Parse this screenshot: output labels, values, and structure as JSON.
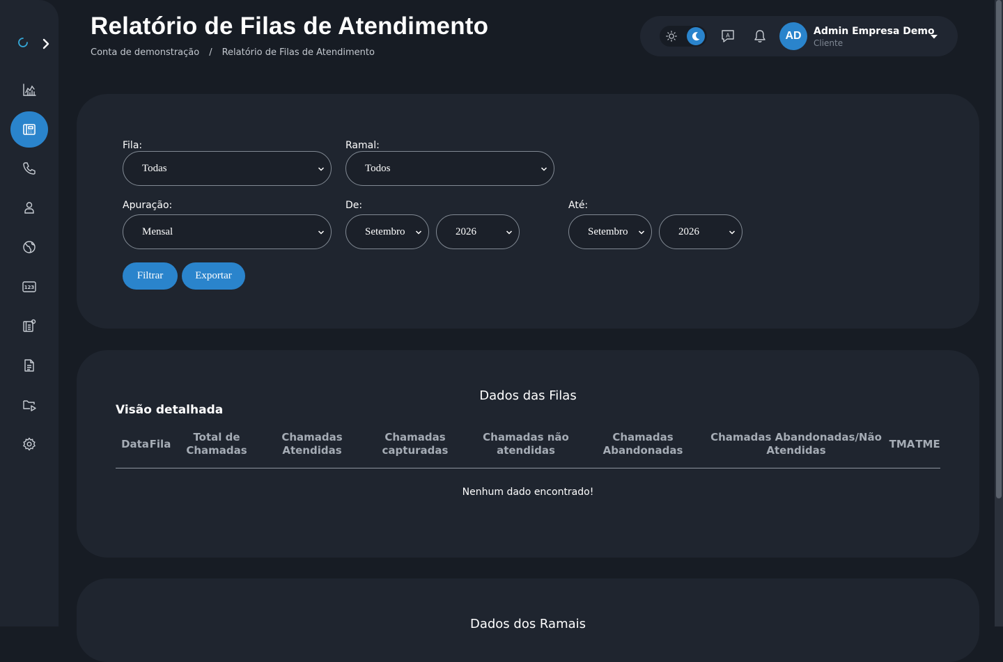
{
  "page": {
    "title": "Relatório de Filas de Atendimento",
    "breadcrumb": [
      "Conta de demonstração",
      "/",
      "Relatório de Filas de Atendimento"
    ]
  },
  "sidebar": {
    "items": [
      {
        "icon": "chart-icon",
        "active": false
      },
      {
        "icon": "queue-report-icon",
        "active": true
      },
      {
        "icon": "phone-icon",
        "active": false
      },
      {
        "icon": "user-icon",
        "active": false
      },
      {
        "icon": "globe-icon",
        "active": false
      },
      {
        "icon": "numeric-123-icon",
        "active": false
      },
      {
        "icon": "contact-card-icon",
        "active": false
      },
      {
        "icon": "document-icon",
        "active": false
      },
      {
        "icon": "folder-play-icon",
        "active": false
      },
      {
        "icon": "gear-icon",
        "active": false
      }
    ]
  },
  "header": {
    "user_initials": "AD",
    "user_name": "Admin Empresa Demo",
    "user_role": "Cliente",
    "icons": [
      "sun-icon",
      "moon-icon",
      "chat-icon",
      "bell-icon",
      "caret-down-icon"
    ]
  },
  "filters": {
    "fila_label": "Fila:",
    "fila_value": "Todas",
    "ramal_label": "Ramal:",
    "ramal_value": "Todos",
    "apuracao_label": "Apuração:",
    "apuracao_value": "Mensal",
    "de_label": "De:",
    "de_month": "Setembro",
    "de_year": "2026",
    "ate_label": "Até:",
    "ate_month": "Setembro",
    "ate_year": "2026",
    "filter_button": "Filtrar",
    "export_button": "Exportar"
  },
  "queues": {
    "title": "Dados das Filas",
    "subheading": "Visão detalhada",
    "columns": [
      "Data",
      "Fila",
      "Total de Chamadas",
      "Chamadas Atendidas",
      "Chamadas capturadas",
      "Chamadas não atendidas",
      "Chamadas Abandonadas",
      "Chamadas Abandonadas/Não Atendidas",
      "TMA",
      "TME"
    ],
    "empty_message": "Nenhum dado encontrado!"
  },
  "extensions": {
    "title": "Dados dos Ramais"
  },
  "colors": {
    "accent": "#2a84cc",
    "background": "#171c24",
    "card": "#1f252f"
  }
}
